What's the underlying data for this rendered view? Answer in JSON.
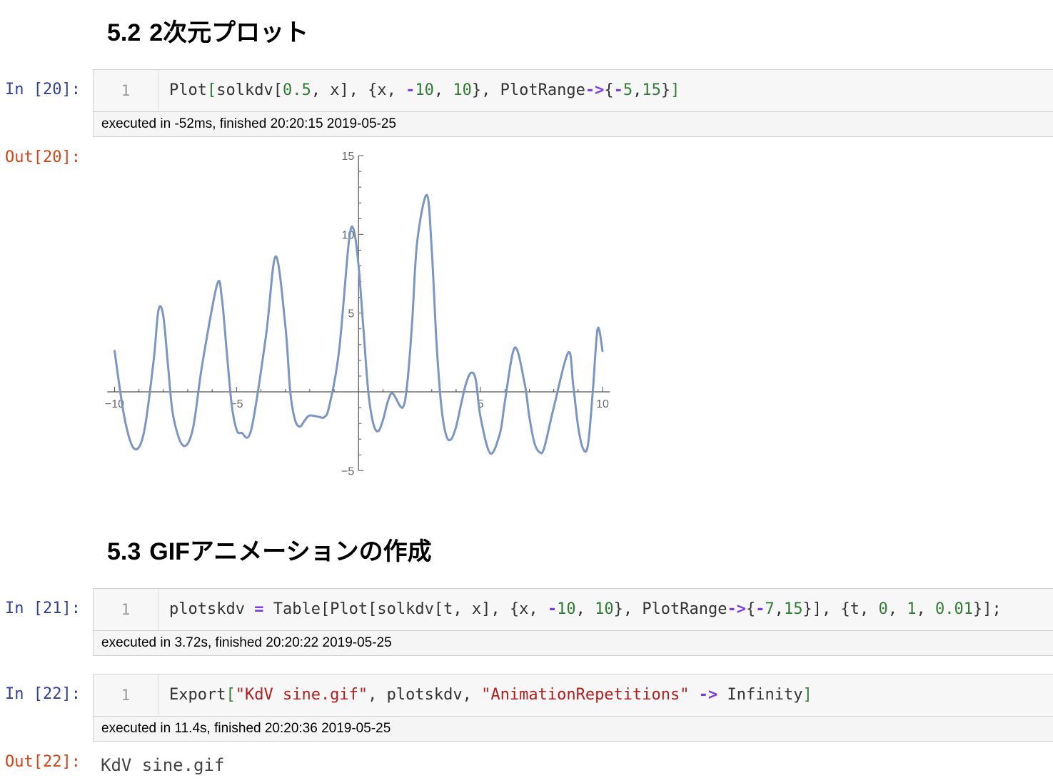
{
  "headings": {
    "plot2d": {
      "number": "5.2",
      "title": "2次元プロット"
    },
    "gif": {
      "number": "5.3",
      "title": "GIFアニメーションの作成"
    }
  },
  "cells": {
    "c20": {
      "prompt": "In [20]:",
      "line": "1",
      "code": {
        "a": "Plot",
        "b": "[",
        "c": "solkdv[",
        "d": "0.5",
        "e": ", x], {x, ",
        "f": "-",
        "g": "10",
        "h": ", ",
        "i": "10",
        "j": "}, PlotRange",
        "k": "->",
        "l": "{",
        "m": "-",
        "n": "5",
        "o": ",",
        "p": "15",
        "q": "}",
        "r": "]"
      },
      "timing": "executed in -52ms, finished 20:20:15 2019-05-25",
      "out_prompt": "Out[20]:"
    },
    "c21": {
      "prompt": "In [21]:",
      "line": "1",
      "code": {
        "a": "plotskdv ",
        "b": "=",
        "c": " Table[Plot[solkdv[t, x], {x, ",
        "d": "-",
        "e": "10",
        "f": ", ",
        "g": "10",
        "h": "}, PlotRange",
        "i": "->",
        "j": "{",
        "k": "-",
        "l": "7",
        "m": ",",
        "n": "15",
        "o": "}], {t, ",
        "p": "0",
        "q": ", ",
        "r": "1",
        "s": ", ",
        "t": "0.01",
        "u": "}];"
      },
      "timing": "executed in 3.72s, finished 20:20:22 2019-05-25"
    },
    "c22": {
      "prompt": "In [22]:",
      "line": "1",
      "code": {
        "a": "Export",
        "b": "[",
        "c": "\"KdV sine.gif\"",
        "d": ", plotskdv, ",
        "e": "\"AnimationRepetitions\"",
        "f": " ",
        "g": "->",
        "h": " Infinity",
        "i": "]"
      },
      "timing": "executed in 11.4s, finished 20:20:36 2019-05-25",
      "out_prompt": "Out[22]:",
      "output": "KdV sine.gif"
    }
  },
  "chart_data": {
    "type": "line",
    "title": "",
    "xlabel": "",
    "ylabel": "",
    "xlim": [
      -10.3,
      10.3
    ],
    "ylim": [
      -5,
      15
    ],
    "grid": false,
    "x_ticks": [
      -10,
      -5,
      5,
      10
    ],
    "x_tick_labels": [
      "−10",
      "−5",
      "5",
      "10"
    ],
    "y_ticks": [
      -5,
      5,
      10,
      15
    ],
    "y_tick_labels": [
      "−5",
      "5",
      "10",
      "15"
    ],
    "line_color": "#7b96c4",
    "series": [
      {
        "x": [
          -10,
          -9.6,
          -9.2,
          -8.8,
          -8.4,
          -8.2,
          -8.0,
          -7.8,
          -7.6,
          -7.2,
          -6.8,
          -6.4,
          -5.8,
          -5.6,
          -5.4,
          -5.2,
          -5.0,
          -4.8,
          -4.4,
          -3.8,
          -3.4,
          -3.0,
          -2.8,
          -2.6,
          -2.4,
          -2.2,
          -2.0,
          -1.6,
          -1.4,
          -1.2,
          -0.8,
          -0.4,
          -0.2,
          0.0,
          0.2,
          0.4,
          0.6,
          0.8,
          1.0,
          1.2,
          1.4,
          1.8,
          2.0,
          2.2,
          2.4,
          2.8,
          3.0,
          3.2,
          3.4,
          3.6,
          3.8,
          4.0,
          4.2,
          4.4,
          4.6,
          4.8,
          5.0,
          5.4,
          5.8,
          6.0,
          6.4,
          6.8,
          7.0,
          7.2,
          7.4,
          7.6,
          8.0,
          8.6,
          8.8,
          9.0,
          9.2,
          9.4,
          9.6,
          9.8,
          10.0
        ],
        "y": [
          2.6,
          -1.6,
          -3.6,
          -2.6,
          2.0,
          5.2,
          4.8,
          1.5,
          -1.5,
          -3.4,
          -2.4,
          1.8,
          6.8,
          5.9,
          2.5,
          -0.8,
          -2.4,
          -2.6,
          -2.4,
          3.5,
          8.6,
          4.2,
          0.0,
          -1.8,
          -2.2,
          -1.8,
          -1.5,
          -1.6,
          -1.6,
          -0.9,
          2.6,
          9.5,
          10.3,
          8.0,
          4.0,
          0.0,
          -2.0,
          -2.5,
          -1.8,
          -0.6,
          -0.1,
          -1.0,
          0.6,
          4.5,
          9.5,
          12.5,
          9.0,
          3.0,
          -1.0,
          -2.8,
          -3.0,
          -2.2,
          -0.8,
          0.5,
          1.2,
          0.8,
          -1.6,
          -3.9,
          -2.6,
          -0.6,
          2.8,
          0.6,
          -1.6,
          -3.2,
          -3.8,
          -3.6,
          -1.0,
          2.5,
          0.4,
          -2.2,
          -3.6,
          -3.4,
          0.0,
          4.0,
          2.6
        ]
      }
    ]
  }
}
